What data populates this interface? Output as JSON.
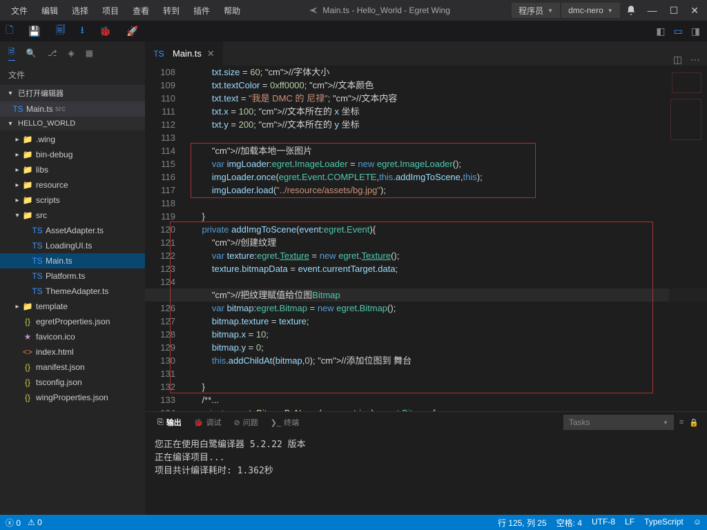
{
  "menubar": {
    "items": [
      "文件",
      "编辑",
      "选择",
      "项目",
      "查看",
      "转到",
      "插件",
      "帮助"
    ],
    "title": "Main.ts - Hello_World - Egret Wing",
    "dropdown1": "程序员",
    "dropdown2": "dmc-nero"
  },
  "sidebar": {
    "header": "文件",
    "open_editors": "已打开编辑器",
    "open_file": {
      "name": "Main.ts",
      "dir": "src"
    },
    "project": "HELLO_WORLD",
    "tree": [
      {
        "d": 1,
        "t": "folder",
        "exp": false,
        "name": ".wing"
      },
      {
        "d": 1,
        "t": "folder",
        "exp": false,
        "name": "bin-debug"
      },
      {
        "d": 1,
        "t": "folder",
        "exp": false,
        "name": "libs"
      },
      {
        "d": 1,
        "t": "folder",
        "exp": false,
        "name": "resource"
      },
      {
        "d": 1,
        "t": "folder",
        "exp": false,
        "name": "scripts"
      },
      {
        "d": 1,
        "t": "folder",
        "exp": true,
        "name": "src"
      },
      {
        "d": 2,
        "t": "ts",
        "name": "AssetAdapter.ts"
      },
      {
        "d": 2,
        "t": "ts",
        "name": "LoadingUI.ts"
      },
      {
        "d": 2,
        "t": "ts",
        "name": "Main.ts",
        "sel": true
      },
      {
        "d": 2,
        "t": "ts",
        "name": "Platform.ts"
      },
      {
        "d": 2,
        "t": "ts",
        "name": "ThemeAdapter.ts"
      },
      {
        "d": 1,
        "t": "folder",
        "exp": false,
        "name": "template"
      },
      {
        "d": 1,
        "t": "json",
        "name": "egretProperties.json"
      },
      {
        "d": 1,
        "t": "ico",
        "name": "favicon.ico"
      },
      {
        "d": 1,
        "t": "html",
        "name": "index.html"
      },
      {
        "d": 1,
        "t": "json",
        "name": "manifest.json"
      },
      {
        "d": 1,
        "t": "json",
        "name": "tsconfig.json"
      },
      {
        "d": 1,
        "t": "json",
        "name": "wingProperties.json"
      }
    ]
  },
  "editor": {
    "tab": "Main.ts",
    "first_line": 108,
    "current_line": 125,
    "lines": [
      "        txt.size = 60; //字体大小",
      "        txt.textColor = 0xff0000; //文本颜色",
      "        txt.text = \"我是 DMC 的 尼禄\"; //文本内容",
      "        txt.x = 100; //文本所在的 x 坐标",
      "        txt.y = 200; //文本所在的 y 坐标",
      "",
      "        //加载本地一张图片",
      "        var imgLoader:egret.ImageLoader = new egret.ImageLoader();",
      "        imgLoader.once(egret.Event.COMPLETE,this.addImgToScene,this);",
      "        imgLoader.load(\"../resource/assets/bg.jpg\");",
      "",
      "    }",
      "    private addImgToScene(event:egret.Event){",
      "        //创建纹理",
      "        var texture:egret.Texture = new egret.Texture();",
      "        texture.bitmapData = event.currentTarget.data;",
      "",
      "        //把纹理赋值给位图Bitmap",
      "        var bitmap:egret.Bitmap = new egret.Bitmap();",
      "        bitmap.texture = texture;",
      "        bitmap.x = 10;",
      "        bitmap.y = 0;",
      "        this.addChildAt(bitmap,0); //添加位图到 舞台",
      "",
      "    }",
      "    /**...",
      "    private createBitmapByName(name: string): egret.Bitmap {..."
    ]
  },
  "panel": {
    "tabs": [
      "输出",
      "调试",
      "问题",
      "终端"
    ],
    "active": 0,
    "tasks": "Tasks",
    "body": "您正在使用白鹭编译器 5.2.22 版本\n正在编译项目...\n项目共计编译耗时: 1.362秒"
  },
  "status": {
    "errors": "0",
    "warnings": "0",
    "cursor": "行 125, 列 25",
    "spaces": "空格: 4",
    "enc": "UTF-8",
    "eol": "LF",
    "lang": "TypeScript"
  }
}
